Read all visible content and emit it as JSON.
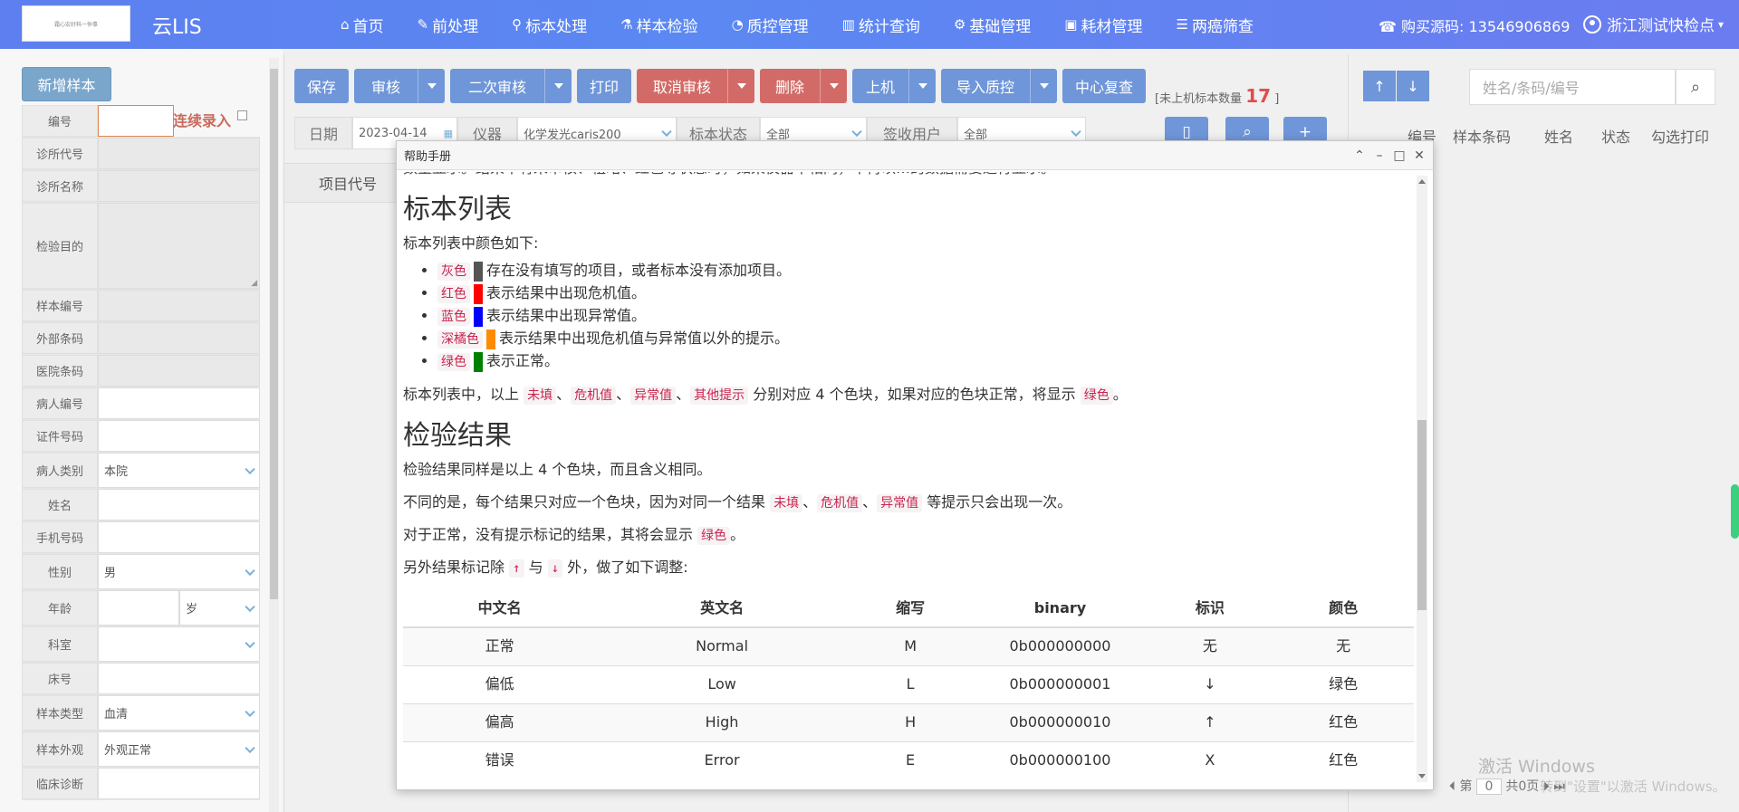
{
  "header": {
    "logo_text": "霜心宏好科一仲事",
    "app_name": "云LIS",
    "nav": [
      {
        "icon": "home-icon",
        "glyph": "⌂",
        "label": "首页"
      },
      {
        "icon": "wrench-icon",
        "glyph": "✎",
        "label": "前处理"
      },
      {
        "icon": "tube-icon",
        "glyph": "⚲",
        "label": "标本处理"
      },
      {
        "icon": "flask-icon",
        "glyph": "⚗",
        "label": "样本检验"
      },
      {
        "icon": "pie-chart-icon",
        "glyph": "◔",
        "label": "质控管理"
      },
      {
        "icon": "bar-chart-icon",
        "glyph": "▥",
        "label": "统计查询"
      },
      {
        "icon": "gear-icon",
        "glyph": "⚙",
        "label": "基础管理"
      },
      {
        "icon": "briefcase-icon",
        "glyph": "▣",
        "label": "耗材管理"
      },
      {
        "icon": "list-icon",
        "glyph": "☰",
        "label": "两癌筛查"
      }
    ],
    "phone": "☎ 购买源码: 13546906869",
    "user": "浙江测试快检点"
  },
  "left_form": {
    "add_button": "新增样本",
    "continuous_label": "连续录入",
    "rows": [
      {
        "label": "编号",
        "value": ""
      },
      {
        "label": "诊所代号",
        "value": ""
      },
      {
        "label": "诊所名称",
        "value": ""
      },
      {
        "label": "检验目的",
        "value": ""
      },
      {
        "label": "样本编号",
        "value": ""
      },
      {
        "label": "外部条码",
        "value": ""
      },
      {
        "label": "医院条码",
        "value": ""
      },
      {
        "label": "病人编号",
        "value": ""
      },
      {
        "label": "证件号码",
        "value": ""
      },
      {
        "label": "病人类别",
        "value": "本院"
      },
      {
        "label": "姓名",
        "value": ""
      },
      {
        "label": "手机号码",
        "value": ""
      },
      {
        "label": "性别",
        "value": "男"
      },
      {
        "label": "年龄",
        "value": "",
        "unit": "岁"
      },
      {
        "label": "科室",
        "value": ""
      },
      {
        "label": "床号",
        "value": ""
      },
      {
        "label": "样本类型",
        "value": "血清"
      },
      {
        "label": "样本外观",
        "value": "外观正常"
      },
      {
        "label": "临床诊断",
        "value": ""
      }
    ]
  },
  "toolbar": {
    "save": "保存",
    "review": "审核",
    "second_review": "二次审核",
    "print": "打印",
    "cancel_review": "取消审核",
    "delete": "删除",
    "upload": "上机",
    "import_qc": "导入质控",
    "center_recheck": "中心复查",
    "unhosted_prefix": "[未上机标本数量",
    "unhosted_count": "17",
    "unhosted_suffix": "]"
  },
  "filter": {
    "date_label": "日期",
    "date_value": "2023-04-14",
    "instrument_label": "仪器",
    "instrument_value": "化学发光caris200",
    "status_label": "标本状态",
    "status_value": "全部",
    "sign_user_label": "签收用户",
    "sign_user_value": "全部"
  },
  "item_column": "项目代号",
  "right": {
    "search_placeholder": "姓名/条码/编号",
    "columns": [
      "编号",
      "样本条码",
      "姓名",
      "状态",
      "勾选打印"
    ],
    "pager_first": "第",
    "pager_page": "0",
    "pager_of": "共0页",
    "watermark_title": "激活 Windows",
    "watermark_sub": "转到\"设置\"以激活 Windows。"
  },
  "modal": {
    "title": "帮助手册",
    "top_cut_text": "数量显示。结果中有未审核、粗略、红色等状态时，如果仪器中相同，不再以…的数据需要进行显示。",
    "h_sample_list": "标本列表",
    "p_colors_intro": "标本列表中颜色如下:",
    "colors": [
      {
        "name": "灰色",
        "hex": "#555555",
        "desc": "存在没有填写的项目，或者标本没有添加项目。"
      },
      {
        "name": "红色",
        "hex": "#ff0000",
        "desc": "表示结果中出现危机值。"
      },
      {
        "name": "蓝色",
        "hex": "#0000ff",
        "desc": "表示结果中出现异常值。"
      },
      {
        "name": "深橘色",
        "hex": "#ff8c00",
        "desc": "表示结果中出现危机值与异常值以外的提示。"
      },
      {
        "name": "绿色",
        "hex": "#008000",
        "desc": "表示正常。"
      }
    ],
    "p_list_1": "标本列表中，以上",
    "tag_unfilled": "未填",
    "sep": "、",
    "tag_critical": "危机值",
    "tag_abnormal": "异常值",
    "tag_other": "其他提示",
    "p_list_2": "分别对应 4 个色块，如果对应的色块正常，将显示",
    "tag_green": "绿色",
    "p_end": "。",
    "h_results": "检验结果",
    "p_results_1": "检验结果同样是以上 4 个色块，而且含义相同。",
    "p_results_2a": "不同的是，每个结果只对应一个色块，因为对同一个结果",
    "p_results_2b": "等提示只会出现一次。",
    "p_results_3a": "对于正常，没有提示标记的结果，其将会显示",
    "p_results_4a": "另外结果标记除",
    "tag_up": "↑",
    "p_results_4b": "与",
    "tag_down": "↓",
    "p_results_4c": "外，做了如下调整:",
    "table_headers": [
      "中文名",
      "英文名",
      "缩写",
      "binary",
      "标识",
      "颜色"
    ],
    "table_rows": [
      [
        "正常",
        "Normal",
        "M",
        "0b000000000",
        "无",
        "无"
      ],
      [
        "偏低",
        "Low",
        "L",
        "0b000000001",
        "↓",
        "绿色"
      ],
      [
        "偏高",
        "High",
        "H",
        "0b000000010",
        "↑",
        "红色"
      ],
      [
        "错误",
        "Error",
        "E",
        "0b000000100",
        "X",
        "红色"
      ]
    ]
  }
}
